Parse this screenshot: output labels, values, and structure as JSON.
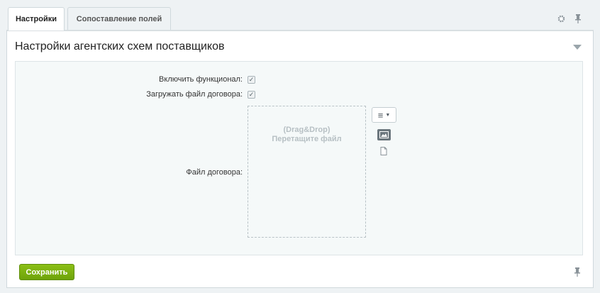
{
  "tabs": [
    {
      "label": "Настройки",
      "active": true
    },
    {
      "label": "Сопоставление полей",
      "active": false
    }
  ],
  "toolbar_icons": [
    "gear-icon",
    "pin-icon"
  ],
  "section": {
    "title": "Настройки агентских схем поставщиков",
    "collapse_icon": "triangle-down-icon"
  },
  "fields": {
    "enable_feature": {
      "label": "Включить функционал:",
      "checked": true
    },
    "upload_contract": {
      "label": "Загружать файл договора:",
      "checked": true
    },
    "contract_file": {
      "label": "Файл договора:"
    }
  },
  "dropzone": {
    "line1": "(Drag&Drop)",
    "line2": "Перетащите файл"
  },
  "file_tools": [
    "menu-icon",
    "image-icon",
    "file-icon"
  ],
  "actions": {
    "save_label": "Сохранить"
  },
  "colors": {
    "accent_green": "#7db311",
    "background": "#eef2f4"
  }
}
